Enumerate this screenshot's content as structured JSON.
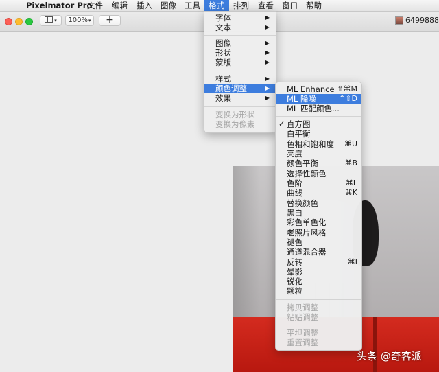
{
  "menubar": {
    "apple_glyph": "",
    "app_name": "Pixelmator Pro",
    "items": [
      "文件",
      "编辑",
      "插入",
      "图像",
      "工具",
      "格式",
      "排列",
      "查看",
      "窗口",
      "帮助"
    ]
  },
  "toolbar": {
    "zoom_label": "100%",
    "add_label": "+",
    "user_name": "6499888"
  },
  "format_menu": {
    "items": [
      {
        "label": "字体",
        "submenu": true
      },
      {
        "label": "文本",
        "submenu": true
      },
      {
        "label": "图像",
        "submenu": true
      },
      {
        "label": "形状",
        "submenu": true
      },
      {
        "label": "蒙版",
        "submenu": true
      },
      {
        "label": "样式",
        "submenu": true
      },
      {
        "label": "颜色调整",
        "submenu": true,
        "highlighted": true
      },
      {
        "label": "效果",
        "submenu": true
      },
      {
        "label": "变换为形状",
        "disabled": true
      },
      {
        "label": "变换为像素",
        "disabled": true
      }
    ]
  },
  "color_menu": {
    "items": [
      {
        "label": "ML Enhance",
        "shortcut": "⇧⌘M"
      },
      {
        "label": "ML 降噪",
        "shortcut": "^⇧D",
        "highlighted": true
      },
      {
        "label": "ML 匹配颜色..."
      },
      {
        "label": "直方图",
        "checked": true
      },
      {
        "label": "白平衡"
      },
      {
        "label": "色相和饱和度",
        "shortcut": "⌘U"
      },
      {
        "label": "亮度"
      },
      {
        "label": "颜色平衡",
        "shortcut": "⌘B"
      },
      {
        "label": "选择性颜色"
      },
      {
        "label": "色阶",
        "shortcut": "⌘L"
      },
      {
        "label": "曲线",
        "shortcut": "⌘K"
      },
      {
        "label": "替换颜色"
      },
      {
        "label": "黑白"
      },
      {
        "label": "彩色单色化"
      },
      {
        "label": "老照片风格"
      },
      {
        "label": "褪色"
      },
      {
        "label": "通道混合器"
      },
      {
        "label": "反转",
        "shortcut": "⌘I"
      },
      {
        "label": "晕影"
      },
      {
        "label": "锐化"
      },
      {
        "label": "颗粒"
      },
      {
        "label": "拷贝调整",
        "disabled": true
      },
      {
        "label": "粘贴调整",
        "disabled": true
      },
      {
        "label": "平坦调整",
        "disabled": true
      },
      {
        "label": "重置调整",
        "disabled": true
      }
    ]
  },
  "icons": {
    "submenu_arrow": "▶",
    "checkmark": "✓"
  },
  "colors": {
    "highlight": "#3d7dde",
    "seat_red": "#d42b1f"
  },
  "watermark": "头条 @奇客派"
}
